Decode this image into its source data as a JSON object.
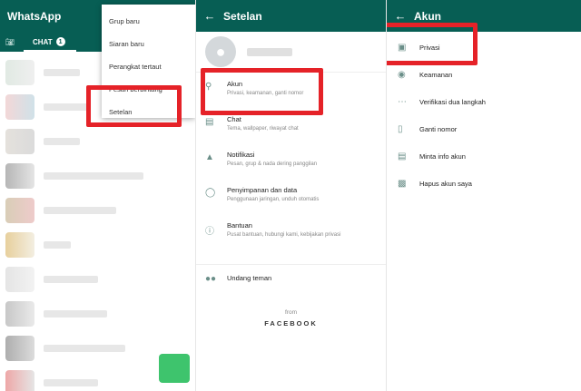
{
  "panel1": {
    "app_title": "WhatsApp",
    "tab_chat": "CHAT",
    "chat_badge": "1",
    "menu": [
      "Grup baru",
      "Siaran baru",
      "Perangkat tertaut",
      "Pesan berbintang",
      "Setelan"
    ]
  },
  "panel2": {
    "title": "Setelan",
    "items": [
      {
        "title": "Akun",
        "sub": "Privasi, keamanan, ganti nomor",
        "icon": "key-icon"
      },
      {
        "title": "Chat",
        "sub": "Tema, wallpaper, riwayat chat",
        "icon": "chat-icon"
      },
      {
        "title": "Notifikasi",
        "sub": "Pesan, grup & nada dering panggilan",
        "icon": "bell-icon"
      },
      {
        "title": "Penyimpanan dan data",
        "sub": "Penggunaan jaringan, unduh otomatis",
        "icon": "storage-icon"
      },
      {
        "title": "Bantuan",
        "sub": "Pusat bantuan, hubungi kami, kebijakan privasi",
        "icon": "help-icon"
      }
    ],
    "invite": "Undang teman",
    "from": "from",
    "brand": "FACEBOOK"
  },
  "panel3": {
    "title": "Akun",
    "items": [
      {
        "label": "Privasi",
        "icon": "lock-icon"
      },
      {
        "label": "Keamanan",
        "icon": "shield-icon"
      },
      {
        "label": "Verifikasi dua langkah",
        "icon": "dots-icon"
      },
      {
        "label": "Ganti nomor",
        "icon": "phone-icon"
      },
      {
        "label": "Minta info akun",
        "icon": "document-icon"
      },
      {
        "label": "Hapus akun saya",
        "icon": "trash-icon"
      }
    ]
  },
  "colors": {
    "header": "#075e54",
    "highlight": "#e52228",
    "icon": "#6b8f89"
  }
}
